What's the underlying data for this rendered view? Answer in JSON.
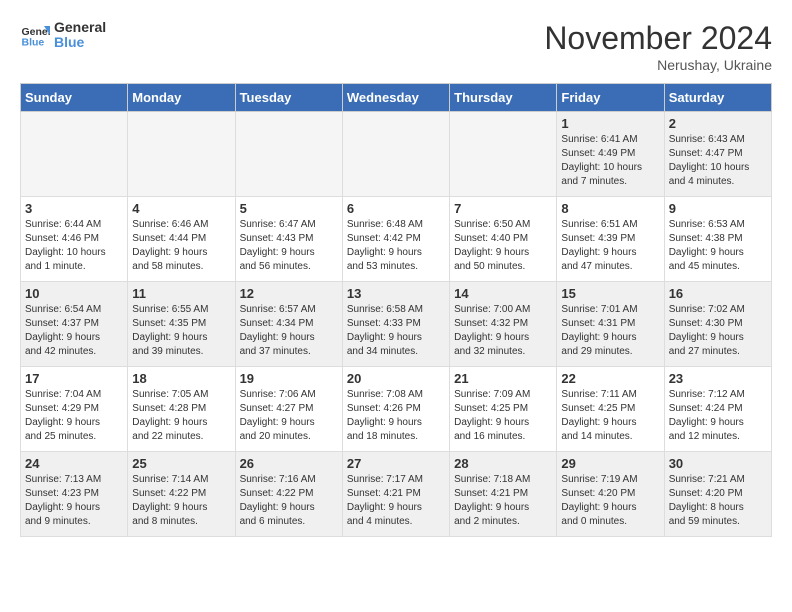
{
  "logo": {
    "line1": "General",
    "line2": "Blue"
  },
  "title": "November 2024",
  "location": "Nerushay, Ukraine",
  "days_of_week": [
    "Sunday",
    "Monday",
    "Tuesday",
    "Wednesday",
    "Thursday",
    "Friday",
    "Saturday"
  ],
  "weeks": [
    [
      {
        "day": "",
        "info": "",
        "empty": true
      },
      {
        "day": "",
        "info": "",
        "empty": true
      },
      {
        "day": "",
        "info": "",
        "empty": true
      },
      {
        "day": "",
        "info": "",
        "empty": true
      },
      {
        "day": "",
        "info": "",
        "empty": true
      },
      {
        "day": "1",
        "info": "Sunrise: 6:41 AM\nSunset: 4:49 PM\nDaylight: 10 hours\nand 7 minutes."
      },
      {
        "day": "2",
        "info": "Sunrise: 6:43 AM\nSunset: 4:47 PM\nDaylight: 10 hours\nand 4 minutes."
      }
    ],
    [
      {
        "day": "3",
        "info": "Sunrise: 6:44 AM\nSunset: 4:46 PM\nDaylight: 10 hours\nand 1 minute."
      },
      {
        "day": "4",
        "info": "Sunrise: 6:46 AM\nSunset: 4:44 PM\nDaylight: 9 hours\nand 58 minutes."
      },
      {
        "day": "5",
        "info": "Sunrise: 6:47 AM\nSunset: 4:43 PM\nDaylight: 9 hours\nand 56 minutes."
      },
      {
        "day": "6",
        "info": "Sunrise: 6:48 AM\nSunset: 4:42 PM\nDaylight: 9 hours\nand 53 minutes."
      },
      {
        "day": "7",
        "info": "Sunrise: 6:50 AM\nSunset: 4:40 PM\nDaylight: 9 hours\nand 50 minutes."
      },
      {
        "day": "8",
        "info": "Sunrise: 6:51 AM\nSunset: 4:39 PM\nDaylight: 9 hours\nand 47 minutes."
      },
      {
        "day": "9",
        "info": "Sunrise: 6:53 AM\nSunset: 4:38 PM\nDaylight: 9 hours\nand 45 minutes."
      }
    ],
    [
      {
        "day": "10",
        "info": "Sunrise: 6:54 AM\nSunset: 4:37 PM\nDaylight: 9 hours\nand 42 minutes."
      },
      {
        "day": "11",
        "info": "Sunrise: 6:55 AM\nSunset: 4:35 PM\nDaylight: 9 hours\nand 39 minutes."
      },
      {
        "day": "12",
        "info": "Sunrise: 6:57 AM\nSunset: 4:34 PM\nDaylight: 9 hours\nand 37 minutes."
      },
      {
        "day": "13",
        "info": "Sunrise: 6:58 AM\nSunset: 4:33 PM\nDaylight: 9 hours\nand 34 minutes."
      },
      {
        "day": "14",
        "info": "Sunrise: 7:00 AM\nSunset: 4:32 PM\nDaylight: 9 hours\nand 32 minutes."
      },
      {
        "day": "15",
        "info": "Sunrise: 7:01 AM\nSunset: 4:31 PM\nDaylight: 9 hours\nand 29 minutes."
      },
      {
        "day": "16",
        "info": "Sunrise: 7:02 AM\nSunset: 4:30 PM\nDaylight: 9 hours\nand 27 minutes."
      }
    ],
    [
      {
        "day": "17",
        "info": "Sunrise: 7:04 AM\nSunset: 4:29 PM\nDaylight: 9 hours\nand 25 minutes."
      },
      {
        "day": "18",
        "info": "Sunrise: 7:05 AM\nSunset: 4:28 PM\nDaylight: 9 hours\nand 22 minutes."
      },
      {
        "day": "19",
        "info": "Sunrise: 7:06 AM\nSunset: 4:27 PM\nDaylight: 9 hours\nand 20 minutes."
      },
      {
        "day": "20",
        "info": "Sunrise: 7:08 AM\nSunset: 4:26 PM\nDaylight: 9 hours\nand 18 minutes."
      },
      {
        "day": "21",
        "info": "Sunrise: 7:09 AM\nSunset: 4:25 PM\nDaylight: 9 hours\nand 16 minutes."
      },
      {
        "day": "22",
        "info": "Sunrise: 7:11 AM\nSunset: 4:25 PM\nDaylight: 9 hours\nand 14 minutes."
      },
      {
        "day": "23",
        "info": "Sunrise: 7:12 AM\nSunset: 4:24 PM\nDaylight: 9 hours\nand 12 minutes."
      }
    ],
    [
      {
        "day": "24",
        "info": "Sunrise: 7:13 AM\nSunset: 4:23 PM\nDaylight: 9 hours\nand 9 minutes."
      },
      {
        "day": "25",
        "info": "Sunrise: 7:14 AM\nSunset: 4:22 PM\nDaylight: 9 hours\nand 8 minutes."
      },
      {
        "day": "26",
        "info": "Sunrise: 7:16 AM\nSunset: 4:22 PM\nDaylight: 9 hours\nand 6 minutes."
      },
      {
        "day": "27",
        "info": "Sunrise: 7:17 AM\nSunset: 4:21 PM\nDaylight: 9 hours\nand 4 minutes."
      },
      {
        "day": "28",
        "info": "Sunrise: 7:18 AM\nSunset: 4:21 PM\nDaylight: 9 hours\nand 2 minutes."
      },
      {
        "day": "29",
        "info": "Sunrise: 7:19 AM\nSunset: 4:20 PM\nDaylight: 9 hours\nand 0 minutes."
      },
      {
        "day": "30",
        "info": "Sunrise: 7:21 AM\nSunset: 4:20 PM\nDaylight: 8 hours\nand 59 minutes."
      }
    ]
  ]
}
